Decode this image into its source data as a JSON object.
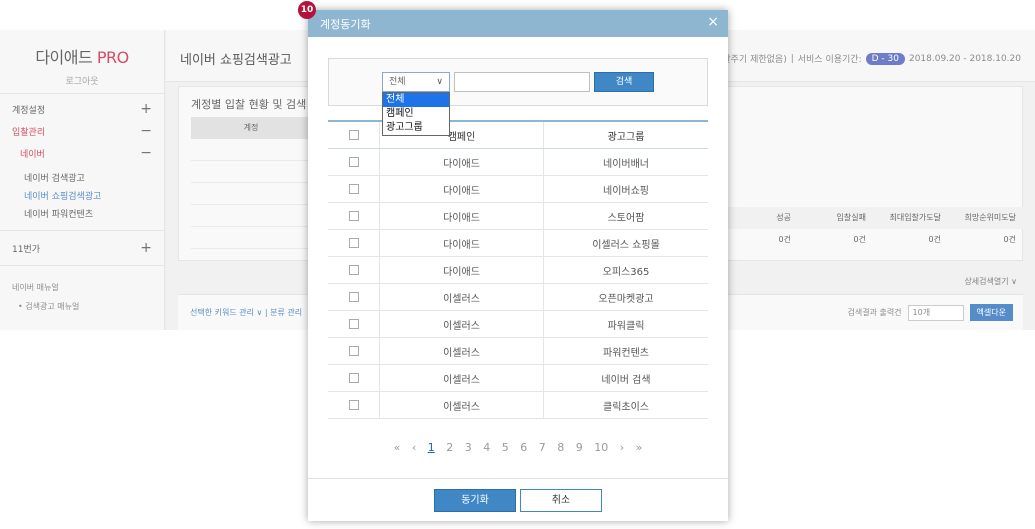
{
  "sidebar": {
    "brand_name": "다이애드",
    "brand_suffix": "PRO",
    "logout": "로그아웃",
    "menu": [
      {
        "label": "계정설정",
        "sign": "+"
      },
      {
        "label": "입찰관리",
        "sign": "−"
      },
      {
        "label": "네이버",
        "sign": "−"
      }
    ],
    "leaves": [
      "네이버 검색광고",
      "네이버 쇼핑검색광고",
      "네이버 파워컨텐츠"
    ],
    "menu_11st": {
      "label": "11번가",
      "sign": "+"
    },
    "manual_title": "네이버 매뉴얼",
    "manual_item": "• 검색광고 매뉴얼"
  },
  "main": {
    "page_title": "네이버 쇼핑검색광고",
    "header_right_a": "퍼플(입찰주기 제한없음)",
    "header_right_b": "서비스 이용기간:",
    "d_badge": "D - 30",
    "period": "2018.09.20 - 2018.10.20",
    "panel_title": "계정별 입찰 현황 및 검색",
    "account_header": "계정",
    "stats_headers": [
      "성공",
      "입찰실패",
      "최대입찰가도달",
      "희망순위미도달"
    ],
    "stats_values": [
      "0건",
      "0건",
      "0건",
      "0건"
    ],
    "detail_link": "상세검색열기 ∨",
    "bb_left": "선택한 키워드 관리 ∨  |  분류 관리",
    "bb_right_label": "검색결과 출력건",
    "bb_select": "10개",
    "bb_btn": "엑셀다운"
  },
  "modal": {
    "step_badge": "10",
    "title": "계정동기화",
    "close": "×",
    "select_value": "전체",
    "search_button": "검색",
    "dropdown_options": [
      "전체",
      "캠페인",
      "광고그룹"
    ],
    "table_headers": [
      "캠페인",
      "광고그룹"
    ],
    "rows": [
      {
        "campaign": "다이애드",
        "group": "네이버배너"
      },
      {
        "campaign": "다이애드",
        "group": "네이버쇼핑"
      },
      {
        "campaign": "다이애드",
        "group": "스토어팜"
      },
      {
        "campaign": "다이애드",
        "group": "이셀러스 쇼핑몰"
      },
      {
        "campaign": "다이애드",
        "group": "오피스365"
      },
      {
        "campaign": "이셀러스",
        "group": "오픈마켓광고"
      },
      {
        "campaign": "이셀러스",
        "group": "파워클릭"
      },
      {
        "campaign": "이셀러스",
        "group": "파워컨텐츠"
      },
      {
        "campaign": "이셀러스",
        "group": "네이버 검색"
      },
      {
        "campaign": "이셀러스",
        "group": "클릭초이스"
      }
    ],
    "pager": {
      "first": "«",
      "prev": "‹",
      "pages": [
        "1",
        "2",
        "3",
        "4",
        "5",
        "6",
        "7",
        "8",
        "9",
        "10"
      ],
      "next": "›",
      "last": "»"
    },
    "sync_button": "동기화",
    "cancel_button": "취소"
  }
}
